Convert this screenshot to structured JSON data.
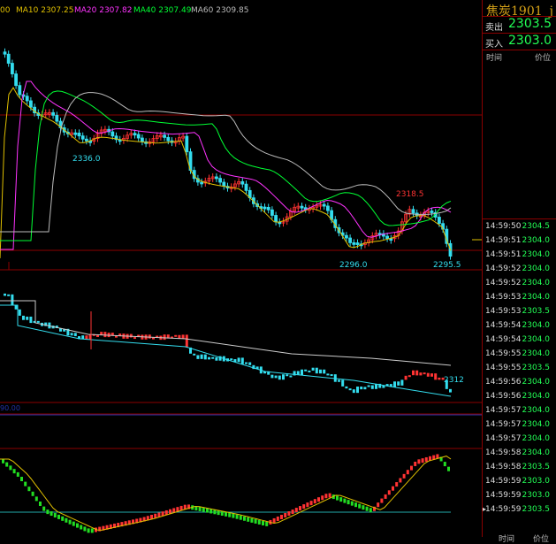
{
  "legend": {
    "ma5_prefix": "00",
    "ma10": "MA10 2307.25",
    "ma20": "MA20 2307.82",
    "ma40": "MA40 2307.49",
    "ma60": "MA60 2309.85"
  },
  "colors": {
    "up": "#ff3333",
    "down": "#33ddee",
    "ma10": "#e0c000",
    "ma20": "#ff33ff",
    "ma40": "#00ff33",
    "ma60": "#bbbbbb",
    "grid": "#8b0000",
    "quote": "#22ff55",
    "title": "#d4a017"
  },
  "annotations": {
    "low1": "2336.0",
    "high1": "2318.5",
    "low2": "2296.0",
    "low3": "2295.5",
    "vol_label": "2312",
    "left_label": "90.00"
  },
  "quote_panel": {
    "title": "焦炭1901",
    "title_suffix": "j",
    "sell_label": "卖出",
    "sell_price": "2303.5",
    "buy_label": "买入",
    "buy_price": "2303.0",
    "time_header": "时间",
    "price_header": "价位",
    "bottom_header_1": "时间",
    "bottom_header_2": "价位",
    "trades": [
      {
        "time": "14:59:50",
        "price": "2304.5"
      },
      {
        "time": "14:59:51",
        "price": "2304.0"
      },
      {
        "time": "14:59:51",
        "price": "2304.0"
      },
      {
        "time": "14:59:52",
        "price": "2304.0"
      },
      {
        "time": "14:59:52",
        "price": "2304.0"
      },
      {
        "time": "14:59:53",
        "price": "2304.0"
      },
      {
        "time": "14:59:53",
        "price": "2303.5"
      },
      {
        "time": "14:59:54",
        "price": "2304.0"
      },
      {
        "time": "14:59:54",
        "price": "2304.0"
      },
      {
        "time": "14:59:55",
        "price": "2304.0"
      },
      {
        "time": "14:59:55",
        "price": "2303.5"
      },
      {
        "time": "14:59:56",
        "price": "2304.0"
      },
      {
        "time": "14:59:56",
        "price": "2304.0"
      },
      {
        "time": "14:59:57",
        "price": "2304.0"
      },
      {
        "time": "14:59:57",
        "price": "2304.0"
      },
      {
        "time": "14:59:57",
        "price": "2304.0"
      },
      {
        "time": "14:59:58",
        "price": "2304.0"
      },
      {
        "time": "14:59:58",
        "price": "2303.5"
      },
      {
        "time": "14:59:59",
        "price": "2303.0"
      },
      {
        "time": "14:59:59",
        "price": "2303.0"
      },
      {
        "time": "14:59:59",
        "price": "2303.5"
      }
    ]
  }
}
